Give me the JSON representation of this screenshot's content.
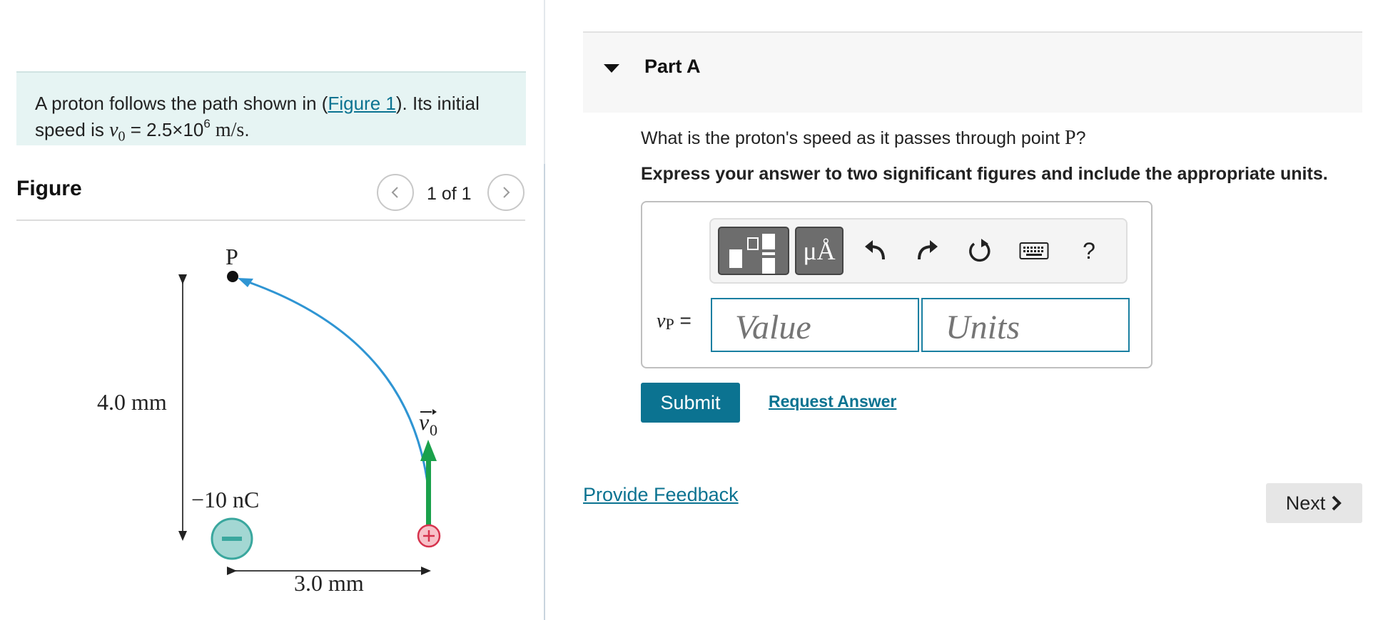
{
  "problem": {
    "text_before": "A proton follows the path shown in (",
    "figure_link": "Figure 1",
    "text_after": "). Its initial speed is ",
    "v_symbol": "v",
    "v_sub": "0",
    "equals": " = 2.5×10",
    "exponent": "6",
    "unit": " m/s",
    "period": "."
  },
  "figure": {
    "title": "Figure",
    "counter": "1 of 1",
    "labels": {
      "point": "P",
      "height": "4.0 mm",
      "charge": "−10 nC",
      "width": "3.0 mm",
      "velocity": "v",
      "velocity_sub": "0",
      "neg_sign": "−",
      "pos_sign": "+"
    },
    "colors": {
      "path": "#2f95d3",
      "arrow": "#1aa14b",
      "neg_charge_fill": "#a3d7d3",
      "neg_charge_stroke": "#3aa79e",
      "pos_charge_fill": "#f7c1c8",
      "pos_charge_stroke": "#d6334d"
    }
  },
  "part": {
    "title": "Part A",
    "question_before": "What is the proton's speed as it passes through point ",
    "question_symbol": "P",
    "question_after": "?",
    "instruction": "Express your answer to two significant figures and include the appropriate units.",
    "variable": "v",
    "variable_sub": "P",
    "equals": " =",
    "value_placeholder": "Value",
    "units_placeholder": "Units",
    "units_button": "μÅ",
    "help_button": "?",
    "icons": [
      "templates-icon",
      "units-icon",
      "undo-icon",
      "redo-icon",
      "reset-icon",
      "keyboard-icon",
      "help-icon"
    ]
  },
  "actions": {
    "submit": "Submit",
    "request_answer": "Request Answer",
    "feedback": "Provide Feedback",
    "next": "Next"
  }
}
